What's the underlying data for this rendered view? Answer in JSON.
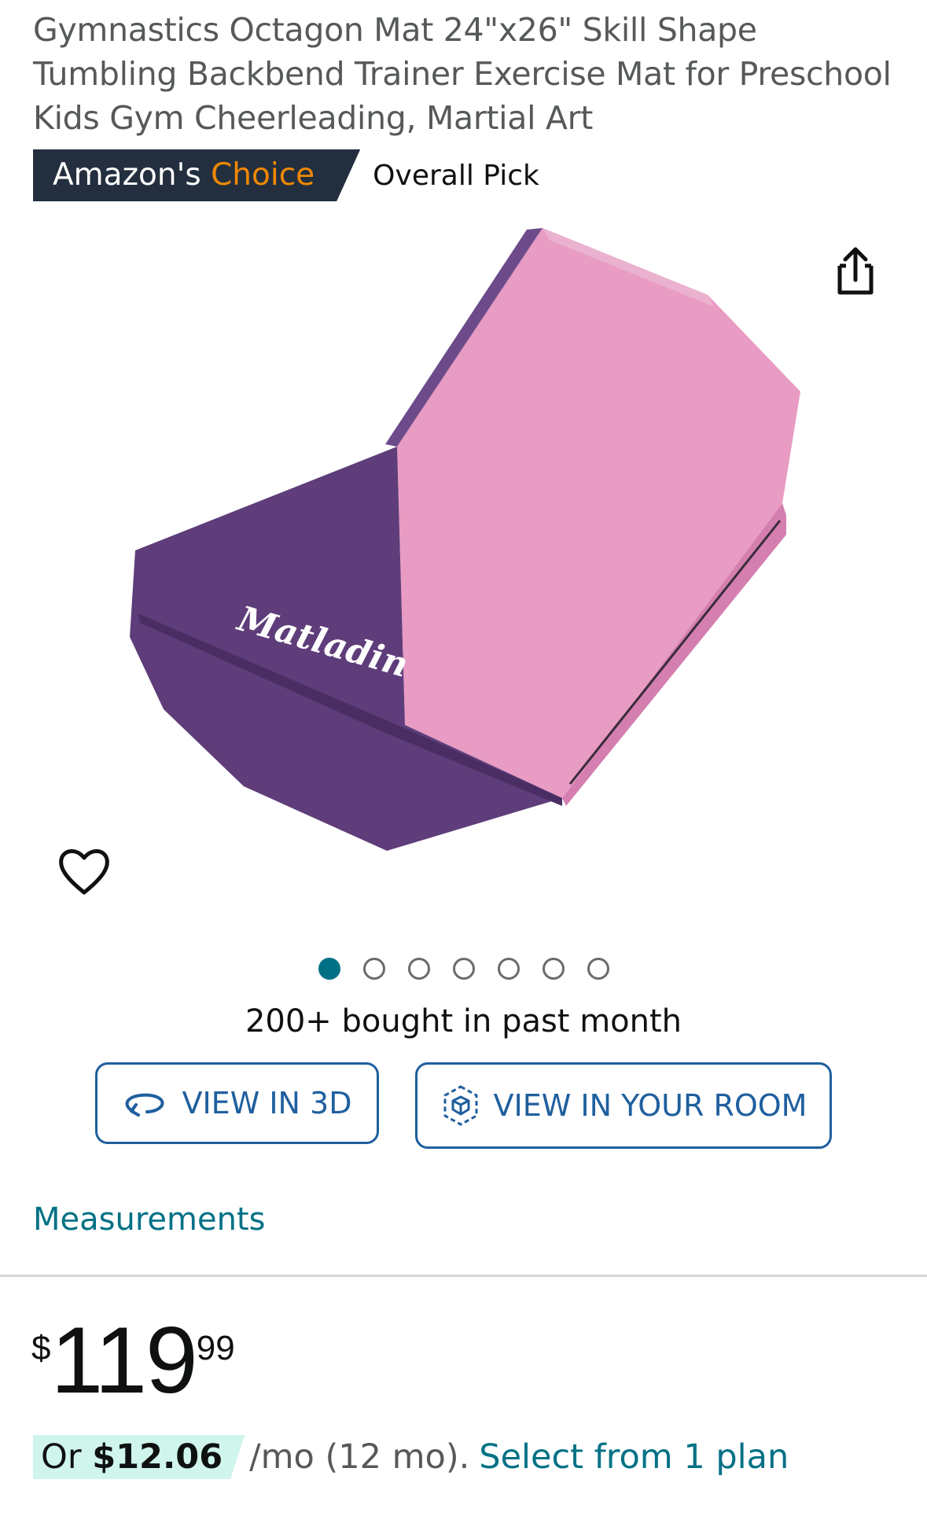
{
  "product": {
    "title": "Gymnastics Octagon Mat 24\"x26\" Skill Shape Tumbling Backbend Trainer Exercise Mat for Preschool Kids Gym Cheerleading, Martial Art",
    "brand_text": "Matladin",
    "image_colors": {
      "top": "#e89bc3",
      "side": "#c9689f",
      "end": "#5e3d7a"
    }
  },
  "badge": {
    "prefix": "Amazon's",
    "highlight": "Choice",
    "label": "Overall Pick"
  },
  "carousel": {
    "total": 7,
    "active_index": 0
  },
  "social_proof": "200+ bought in past month",
  "buttons": {
    "view_3d": "VIEW IN 3D",
    "view_room": "VIEW IN YOUR ROOM"
  },
  "measurements_link": "Measurements",
  "price": {
    "symbol": "$",
    "whole": "119",
    "fraction": "99"
  },
  "installment": {
    "prefix": "Or",
    "amount": "$12.06",
    "terms": "/mo (12 mo).",
    "link": "Select from 1 plan"
  },
  "icons": {
    "share": "share-icon",
    "heart": "heart-icon",
    "rotate": "rotate-3d-icon",
    "ar": "ar-cube-icon"
  },
  "colors": {
    "accent_teal": "#007185",
    "choice_orange": "#f08804",
    "badge_navy": "#232f3e",
    "button_blue": "#1f5f9e"
  }
}
